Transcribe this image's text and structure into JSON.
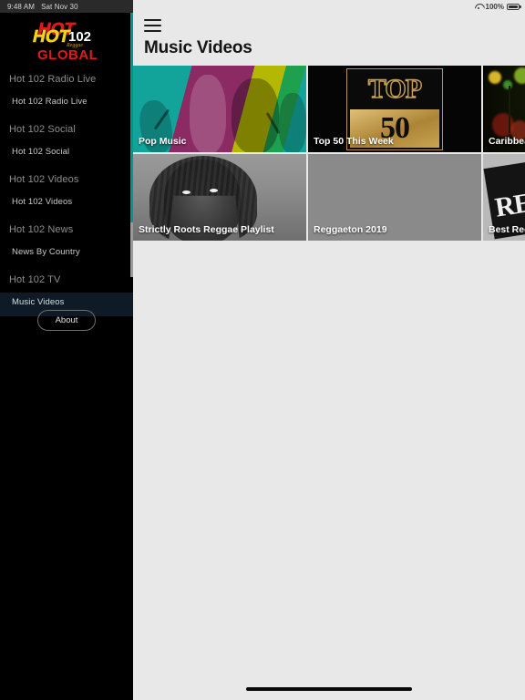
{
  "status_bar": {
    "time": "9:48 AM",
    "date": "Sat Nov 30",
    "battery_percent": "100%",
    "wifi_icon": "wifi-icon",
    "battery_icon": "battery-icon"
  },
  "sidebar": {
    "logo": {
      "line1": "HOT",
      "line2": "102",
      "line3": "Reggae",
      "line4": "GLOBAL",
      "colors": {
        "hot_red": "#e01a17",
        "hot_yellow": "#f2d21a",
        "global_red": "#e01a17",
        "number_white": "#ffffff"
      }
    },
    "sections": [
      {
        "title": "Hot 102 Radio Live",
        "items": [
          {
            "label": "Hot 102 Radio Live",
            "selected": false
          }
        ]
      },
      {
        "title": "Hot 102 Social",
        "items": [
          {
            "label": "Hot 102 Social",
            "selected": false
          }
        ]
      },
      {
        "title": "Hot 102 Videos",
        "items": [
          {
            "label": "Hot 102 Videos",
            "selected": false
          }
        ]
      },
      {
        "title": "Hot 102 News",
        "items": [
          {
            "label": "News By Country",
            "selected": false
          }
        ]
      },
      {
        "title": "Hot 102 TV",
        "items": [
          {
            "label": "Music Videos",
            "selected": true
          }
        ]
      }
    ],
    "about_label": "About",
    "scrollbar_color": "#009688",
    "selected_bg": "#0e1a26"
  },
  "header": {
    "menu_icon": "hamburger-menu-icon",
    "title": "Music Videos"
  },
  "cards": [
    [
      {
        "label": "Pop Music",
        "art": "pop"
      },
      {
        "label": "Top 50 This Week",
        "art": "top50",
        "art_text_top": "TOP",
        "art_text_bottom": "50"
      },
      {
        "label": "Caribbean",
        "art": "caribbean"
      }
    ],
    [
      {
        "label": "Strictly Roots  Reggae Playlist",
        "art": "roots"
      },
      {
        "label": "Reggaeton 2019",
        "art": "reggaeton"
      },
      {
        "label": "Best Reggae",
        "art": "best",
        "art_text": "RE"
      }
    ]
  ],
  "home_indicator": "home-indicator"
}
